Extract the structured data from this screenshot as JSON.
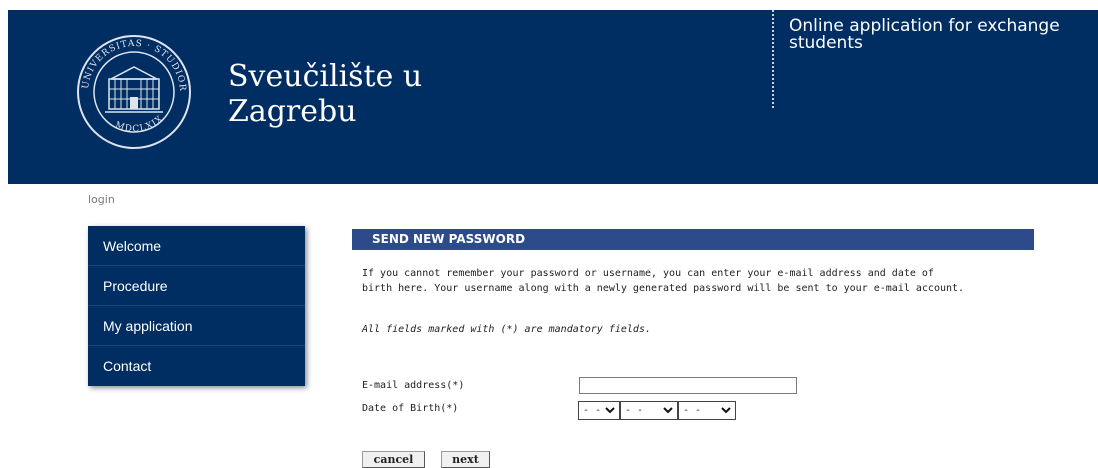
{
  "header": {
    "brand_line1": "Sveučilište u",
    "brand_line2": "Zagrebu",
    "app_title": "Online application for exchange students",
    "colors": {
      "banner": "#002d62",
      "divider": "#c9d3e2"
    },
    "seal": {
      "top_text": "UNIVERSITAS · STUDIORUM · ZAGRABIENSIS",
      "year": "MDCLXIX"
    }
  },
  "breadcrumb": {
    "text": "login"
  },
  "sidebar": {
    "items": [
      {
        "label": "Welcome"
      },
      {
        "label": "Procedure"
      },
      {
        "label": "My application"
      },
      {
        "label": "Contact"
      }
    ]
  },
  "main": {
    "section_title": "SEND NEW PASSWORD",
    "intro_line1": "If you cannot remember your password or username, you can enter your e-mail address and date of",
    "intro_line2": "birth here. Your username along with a newly generated password will be sent to your e-mail account.",
    "mandatory_note": "All fields marked with (*) are mandatory fields.",
    "form": {
      "email_label": "E-mail address(*)",
      "email_value": "",
      "dob_label": "Date of Birth(*)",
      "day_value": "- -",
      "month_value": "- -",
      "year_value": "- -"
    },
    "buttons": {
      "cancel": "cancel",
      "next": "next"
    }
  }
}
